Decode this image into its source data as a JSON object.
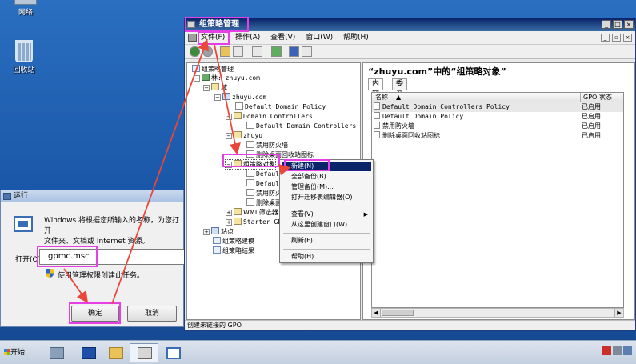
{
  "desktop": {
    "network_label": "网络",
    "recycle_label": "回收站"
  },
  "run_dialog": {
    "title": "运行",
    "description": "Windows 将根据您所输入的名称，为您打开\n文件夹、文档或 Internet 资源。",
    "open_label": "打开(O):",
    "input_value": "gpmc.msc",
    "admin_note": "使用管理权限创建此任务。",
    "ok_label": "确定",
    "cancel_label": "取消"
  },
  "gpmc": {
    "title": "组策略管理",
    "window_controls": [
      "_",
      "□",
      "×"
    ],
    "menu": [
      "文件(F)",
      "操作(A)",
      "查看(V)",
      "窗口(W)",
      "帮助(H)"
    ],
    "inner_controls": [
      "_",
      "▫",
      "×"
    ],
    "tree": {
      "root": "组策略管理",
      "forest": "林: zhuyu.com",
      "domains": "域",
      "domain": "zhuyu.com",
      "default_domain_policy": "Default Domain Policy",
      "domain_controllers": "Domain Controllers",
      "default_dc_policy": "Default Domain Controllers Po",
      "ou": "zhuyu",
      "firewall": "禁用防火墙",
      "remove_recycle": "删除桌面回收站图标",
      "gpo_container": "组策略对象",
      "gpo_1": "Default",
      "gpo_2": "Default",
      "gpo_3": "禁用防火",
      "gpo_4": "删除桌面",
      "wmi": "WMI 筛选器",
      "starter": "Starter GPO",
      "sites": "站点",
      "modeling": "组策略建模",
      "results": "组策略结果"
    },
    "right_pane": {
      "heading": "“zhuyu.com”中的“组策略对象”",
      "tabs": [
        "内容",
        "委派"
      ],
      "columns": {
        "name": "名称",
        "status": "GPO 状态"
      },
      "rows": [
        {
          "name": "Default Domain Controllers Policy",
          "status": "已启用"
        },
        {
          "name": "Default Domain Policy",
          "status": "已启用"
        },
        {
          "name": "禁用防火墙",
          "status": "已启用"
        },
        {
          "name": "删除桌面回收站图标",
          "status": "已启用"
        }
      ]
    },
    "status": "创建未链接的 GPO"
  },
  "context_menu": {
    "new": "新建(N)",
    "backup_all": "全部备份(B)...",
    "manage_backups": "管理备份(M)...",
    "migration_editor": "打开迁移表编辑器(O)",
    "view": "查看(V)",
    "new_window": "从这里创建窗口(W)",
    "refresh": "刷新(F)",
    "help": "帮助(H)"
  },
  "taskbar": {
    "start_label": "开始"
  },
  "colors": {
    "highlight": "#e63fe6",
    "arrow": "#e8473a",
    "title_bar": "#0a246a"
  }
}
